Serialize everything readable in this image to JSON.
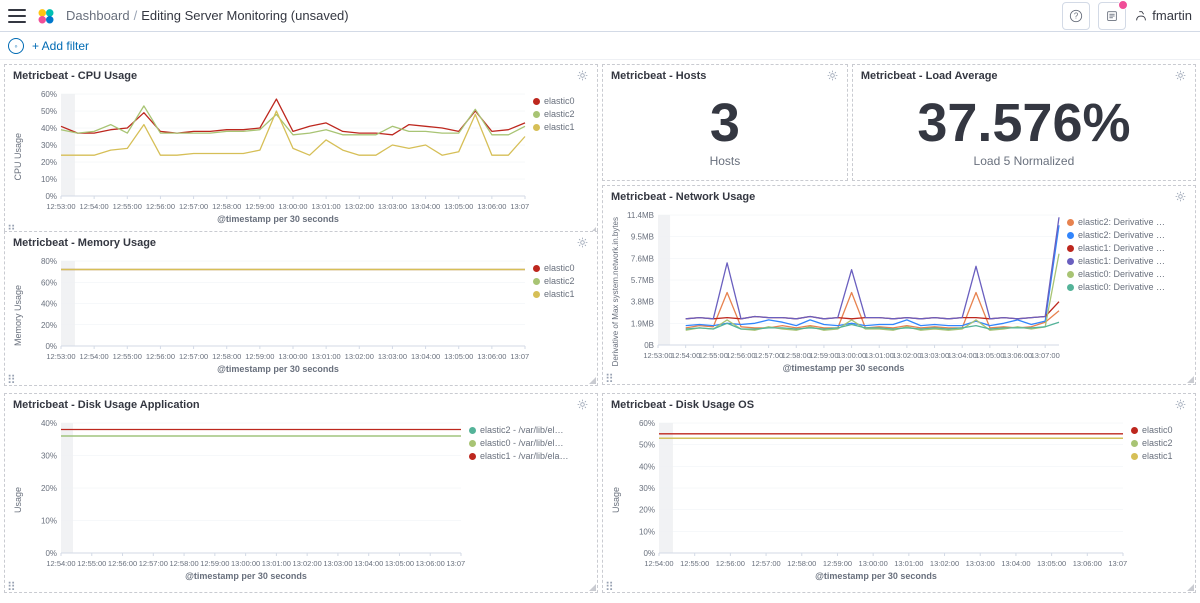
{
  "topbar": {
    "breadcrumb_root": "Dashboard",
    "breadcrumb_current": "Editing Server Monitoring (unsaved)",
    "user": "fmartin"
  },
  "filterbar": {
    "add_filter": "+ Add filter",
    "save": ""
  },
  "colors": {
    "elastic0": "#bd271e",
    "elastic1": "#d6bf57",
    "elastic2": "#a8c474",
    "teal": "#54b399",
    "green": "#a8c474",
    "red": "#bd271e",
    "blue": "#3185fc",
    "orange": "#e7824f",
    "purple": "#6a5fbf"
  },
  "xAxisLabel": "@timestamp per 30 seconds",
  "xTicks": [
    "12:53:00",
    "12:54:00",
    "12:55:00",
    "12:56:00",
    "12:57:00",
    "12:58:00",
    "12:59:00",
    "13:00:00",
    "13:01:00",
    "13:02:00",
    "13:03:00",
    "13:04:00",
    "13:05:00",
    "13:06:00",
    "13:07:00"
  ],
  "panels": {
    "cpu": {
      "title": "Metricbeat - CPU Usage",
      "ylabel": "CPU Usage",
      "legend": [
        {
          "name": "elastic0",
          "color": "#bd271e"
        },
        {
          "name": "elastic2",
          "color": "#a8c474"
        },
        {
          "name": "elastic1",
          "color": "#d6bf57"
        }
      ]
    },
    "memory": {
      "title": "Metricbeat - Memory Usage",
      "ylabel": "Memory Usage",
      "legend": [
        {
          "name": "elastic0",
          "color": "#bd271e"
        },
        {
          "name": "elastic2",
          "color": "#a8c474"
        },
        {
          "name": "elastic1",
          "color": "#d6bf57"
        }
      ]
    },
    "hosts": {
      "title": "Metricbeat - Hosts",
      "value": "3",
      "label": "Hosts"
    },
    "load": {
      "title": "Metricbeat - Load Average",
      "value": "37.576%",
      "label": "Load 5 Normalized"
    },
    "network": {
      "title": "Metricbeat - Network Usage",
      "ylabel": "Derivative of Max system.network.in.bytes",
      "legend": [
        {
          "name": "elastic2: Derivative …",
          "color": "#e7824f"
        },
        {
          "name": "elastic2: Derivative …",
          "color": "#3185fc"
        },
        {
          "name": "elastic1: Derivative …",
          "color": "#bd271e"
        },
        {
          "name": "elastic1: Derivative …",
          "color": "#6a5fbf"
        },
        {
          "name": "elastic0: Derivative …",
          "color": "#a8c474"
        },
        {
          "name": "elastic0: Derivative …",
          "color": "#54b399"
        }
      ]
    },
    "diskApp": {
      "title": "Metricbeat - Disk Usage Application",
      "ylabel": "Usage",
      "legend": [
        {
          "name": "elastic2 - /var/lib/el…",
          "color": "#54b399"
        },
        {
          "name": "elastic0 - /var/lib/el…",
          "color": "#a8c474"
        },
        {
          "name": "elastic1 - /var/lib/ela…",
          "color": "#bd271e"
        }
      ]
    },
    "diskOS": {
      "title": "Metricbeat - Disk Usage OS",
      "ylabel": "Usage",
      "legend": [
        {
          "name": "elastic0",
          "color": "#bd271e"
        },
        {
          "name": "elastic2",
          "color": "#a8c474"
        },
        {
          "name": "elastic1",
          "color": "#d6bf57"
        }
      ]
    }
  },
  "chart_data": [
    {
      "id": "cpu",
      "type": "line",
      "xlabel": "@timestamp per 30 seconds",
      "ylabel": "CPU Usage",
      "ylim": [
        0,
        60
      ],
      "yTicks": [
        "0%",
        "10%",
        "20%",
        "30%",
        "40%",
        "50%",
        "60%"
      ],
      "categories": [
        "12:53:00",
        "12:53:30",
        "12:54:00",
        "12:54:30",
        "12:55:00",
        "12:55:30",
        "12:56:00",
        "12:56:30",
        "12:57:00",
        "12:57:30",
        "12:58:00",
        "12:58:30",
        "12:59:00",
        "12:59:30",
        "13:00:00",
        "13:00:30",
        "13:01:00",
        "13:01:30",
        "13:02:00",
        "13:02:30",
        "13:03:00",
        "13:03:30",
        "13:04:00",
        "13:04:30",
        "13:05:00",
        "13:05:30",
        "13:06:00",
        "13:06:30",
        "13:07:00"
      ],
      "series": [
        {
          "name": "elastic0",
          "color": "#bd271e",
          "values": [
            41,
            37,
            37,
            39,
            40,
            49,
            38,
            37,
            38,
            38,
            39,
            39,
            40,
            57,
            38,
            41,
            43,
            38,
            37,
            37,
            36,
            42,
            41,
            40,
            38,
            50,
            38,
            39,
            43
          ]
        },
        {
          "name": "elastic2",
          "color": "#a8c474",
          "values": [
            39,
            37,
            38,
            42,
            37,
            53,
            37,
            37,
            37,
            37,
            38,
            38,
            39,
            48,
            36,
            37,
            39,
            36,
            36,
            36,
            41,
            38,
            38,
            37,
            37,
            51,
            36,
            36,
            41
          ]
        },
        {
          "name": "elastic1",
          "color": "#d6bf57",
          "values": [
            24,
            24,
            24,
            27,
            28,
            42,
            24,
            24,
            25,
            25,
            25,
            25,
            27,
            50,
            28,
            24,
            33,
            27,
            24,
            24,
            30,
            28,
            30,
            24,
            26,
            48,
            24,
            24,
            35
          ]
        }
      ]
    },
    {
      "id": "memory",
      "type": "line",
      "xlabel": "@timestamp per 30 seconds",
      "ylabel": "Memory Usage",
      "ylim": [
        0,
        80
      ],
      "yTicks": [
        "0%",
        "20%",
        "40%",
        "60%",
        "80%"
      ],
      "categories": [
        "12:53:00",
        "12:54:00",
        "12:55:00",
        "12:56:00",
        "12:57:00",
        "12:58:00",
        "12:59:00",
        "13:00:00",
        "13:01:00",
        "13:02:00",
        "13:03:00",
        "13:04:00",
        "13:05:00",
        "13:06:00",
        "13:07:00"
      ],
      "series": [
        {
          "name": "elastic0",
          "color": "#bd271e",
          "values": [
            72,
            72,
            72,
            72,
            72,
            72,
            72,
            72,
            72,
            72,
            72,
            72,
            72,
            72,
            72
          ]
        },
        {
          "name": "elastic2",
          "color": "#a8c474",
          "values": [
            72,
            72,
            72,
            72,
            72,
            72,
            72,
            72,
            72,
            72,
            72,
            72,
            72,
            72,
            72
          ]
        },
        {
          "name": "elastic1",
          "color": "#d6bf57",
          "values": [
            72,
            72,
            72,
            72,
            72,
            72,
            72,
            72,
            72,
            72,
            72,
            72,
            72,
            72,
            72
          ]
        }
      ]
    },
    {
      "id": "network",
      "type": "line",
      "xlabel": "@timestamp per 30 seconds",
      "ylabel": "Derivative of Max system.network.in.bytes",
      "ylim": [
        0,
        11.4
      ],
      "yTicks": [
        "0B",
        "1.9MB",
        "3.8MB",
        "5.7MB",
        "7.6MB",
        "9.5MB",
        "11.4MB"
      ],
      "categories": [
        "12:53:00",
        "12:53:30",
        "12:54:00",
        "12:54:30",
        "12:55:00",
        "12:55:30",
        "12:56:00",
        "12:56:30",
        "12:57:00",
        "12:57:30",
        "12:58:00",
        "12:58:30",
        "12:59:00",
        "12:59:30",
        "13:00:00",
        "13:00:30",
        "13:01:00",
        "13:01:30",
        "13:02:00",
        "13:02:30",
        "13:03:00",
        "13:03:30",
        "13:04:00",
        "13:04:30",
        "13:05:00",
        "13:05:30",
        "13:06:00",
        "13:06:30",
        "13:07:00",
        "13:07:30"
      ],
      "series": [
        {
          "name": "elastic2: Derivative …",
          "color": "#e7824f",
          "values": [
            null,
            null,
            1.5,
            1.7,
            1.6,
            4.6,
            1.6,
            1.5,
            1.5,
            1.7,
            1.5,
            1.7,
            1.5,
            1.5,
            4.6,
            1.5,
            1.6,
            1.5,
            1.7,
            1.5,
            1.6,
            1.5,
            1.5,
            4.6,
            1.5,
            1.6,
            1.5,
            1.6,
            2.0,
            3.0
          ]
        },
        {
          "name": "elastic2: Derivative …",
          "color": "#3185fc",
          "values": [
            null,
            null,
            1.7,
            1.8,
            1.7,
            1.9,
            1.8,
            1.9,
            2.2,
            2.0,
            1.7,
            2.2,
            1.8,
            1.7,
            1.9,
            1.7,
            1.8,
            1.8,
            2.2,
            1.7,
            1.8,
            1.7,
            1.7,
            2.1,
            1.7,
            1.9,
            2.2,
            1.8,
            2.1,
            10.5
          ]
        },
        {
          "name": "elastic1: Derivative …",
          "color": "#bd271e",
          "values": [
            null,
            null,
            2.3,
            2.4,
            2.3,
            2.4,
            2.3,
            2.5,
            2.4,
            2.4,
            2.3,
            2.5,
            2.3,
            2.4,
            2.3,
            2.4,
            2.4,
            2.3,
            2.4,
            2.3,
            2.4,
            2.3,
            2.4,
            2.4,
            2.3,
            2.4,
            2.3,
            2.4,
            2.5,
            3.8
          ]
        },
        {
          "name": "elastic1: Derivative …",
          "color": "#6a5fbf",
          "values": [
            null,
            null,
            2.3,
            2.4,
            2.3,
            7.2,
            2.3,
            2.5,
            2.4,
            2.4,
            2.3,
            2.5,
            2.3,
            2.4,
            6.6,
            2.4,
            2.4,
            2.3,
            2.4,
            2.3,
            2.4,
            2.3,
            2.4,
            6.9,
            2.3,
            2.4,
            2.3,
            2.4,
            2.5,
            11.2
          ]
        },
        {
          "name": "elastic0: Derivative …",
          "color": "#a8c474",
          "values": [
            null,
            null,
            1.3,
            1.5,
            1.4,
            2.2,
            1.4,
            1.3,
            1.6,
            1.4,
            1.3,
            1.6,
            1.3,
            1.4,
            2.2,
            1.4,
            1.4,
            1.3,
            1.6,
            1.3,
            1.4,
            1.3,
            1.4,
            2.2,
            1.3,
            1.4,
            1.6,
            1.4,
            1.6,
            8.0
          ]
        },
        {
          "name": "elastic0: Derivative …",
          "color": "#54b399",
          "values": [
            null,
            null,
            1.4,
            1.5,
            1.4,
            1.9,
            1.4,
            1.4,
            1.5,
            1.5,
            1.4,
            1.5,
            1.4,
            1.5,
            1.8,
            1.5,
            1.5,
            1.4,
            1.5,
            1.4,
            1.5,
            1.4,
            1.5,
            1.7,
            1.4,
            1.5,
            1.5,
            1.5,
            1.6,
            2.0
          ]
        }
      ]
    },
    {
      "id": "diskApp",
      "type": "line",
      "xlabel": "@timestamp per 30 seconds",
      "ylabel": "Usage",
      "ylim": [
        0,
        40
      ],
      "yTicks": [
        "0%",
        "10%",
        "20%",
        "30%",
        "40%"
      ],
      "categories": [
        "12:54:00",
        "12:55:00",
        "12:56:00",
        "12:57:00",
        "12:58:00",
        "12:59:00",
        "13:00:00",
        "13:01:00",
        "13:02:00",
        "13:03:00",
        "13:04:00",
        "13:05:00",
        "13:06:00",
        "13:07:00"
      ],
      "series": [
        {
          "name": "elastic2 - /var/lib/el…",
          "color": "#54b399",
          "values": [
            36,
            36,
            36,
            36,
            36,
            36,
            36,
            36,
            36,
            36,
            36,
            36,
            36,
            36
          ]
        },
        {
          "name": "elastic0 - /var/lib/el…",
          "color": "#a8c474",
          "values": [
            36,
            36,
            36,
            36,
            36,
            36,
            36,
            36,
            36,
            36,
            36,
            36,
            36,
            36
          ]
        },
        {
          "name": "elastic1 - /var/lib/ela…",
          "color": "#bd271e",
          "values": [
            38,
            38,
            38,
            38,
            38,
            38,
            38,
            38,
            38,
            38,
            38,
            38,
            38,
            38
          ]
        }
      ]
    },
    {
      "id": "diskOS",
      "type": "line",
      "xlabel": "@timestamp per 30 seconds",
      "ylabel": "Usage",
      "ylim": [
        0,
        60
      ],
      "yTicks": [
        "0%",
        "10%",
        "20%",
        "30%",
        "40%",
        "50%",
        "60%"
      ],
      "categories": [
        "12:54:00",
        "12:55:00",
        "12:56:00",
        "12:57:00",
        "12:58:00",
        "12:59:00",
        "13:00:00",
        "13:01:00",
        "13:02:00",
        "13:03:00",
        "13:04:00",
        "13:05:00",
        "13:06:00",
        "13:07:00"
      ],
      "series": [
        {
          "name": "elastic0",
          "color": "#bd271e",
          "values": [
            55,
            55,
            55,
            55,
            55,
            55,
            55,
            55,
            55,
            55,
            55,
            55,
            55,
            55
          ]
        },
        {
          "name": "elastic2",
          "color": "#a8c474",
          "values": [
            53,
            53,
            53,
            53,
            53,
            53,
            53,
            53,
            53,
            53,
            53,
            53,
            53,
            53
          ]
        },
        {
          "name": "elastic1",
          "color": "#d6bf57",
          "values": [
            53,
            53,
            53,
            53,
            53,
            53,
            53,
            53,
            53,
            53,
            53,
            53,
            53,
            53
          ]
        }
      ]
    }
  ]
}
